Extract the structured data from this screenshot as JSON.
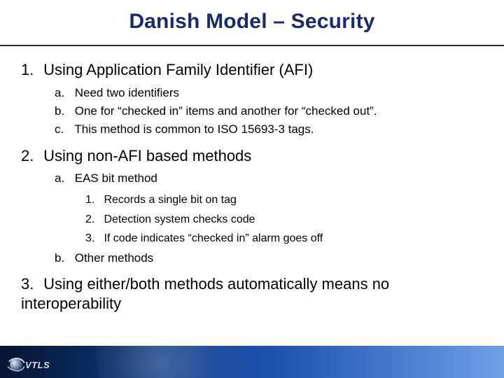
{
  "title": "Danish Model – Security",
  "items": [
    {
      "marker": "1.",
      "text": "Using Application Family Identifier (AFI)",
      "sub": [
        {
          "marker": "a.",
          "text": "Need two identifiers"
        },
        {
          "marker": "b.",
          "text": "One for “checked in” items and another for “checked out”."
        },
        {
          "marker": "c.",
          "text": "This method is common to ISO 15693-3 tags."
        }
      ]
    },
    {
      "marker": "2.",
      "text": "Using non-AFI based methods",
      "sub": [
        {
          "marker": "a.",
          "text": "EAS bit method",
          "sub": [
            {
              "marker": "1.",
              "text": "Records a single bit on tag"
            },
            {
              "marker": "2.",
              "text": "Detection system checks code"
            },
            {
              "marker": "3.",
              "text": "If code indicates “checked in” alarm goes off"
            }
          ]
        },
        {
          "marker": "b.",
          "text": "Other methods"
        }
      ]
    },
    {
      "marker": "3.",
      "text": "Using either/both methods automatically means no interoperability"
    }
  ],
  "logo": {
    "text": "VTLS"
  }
}
